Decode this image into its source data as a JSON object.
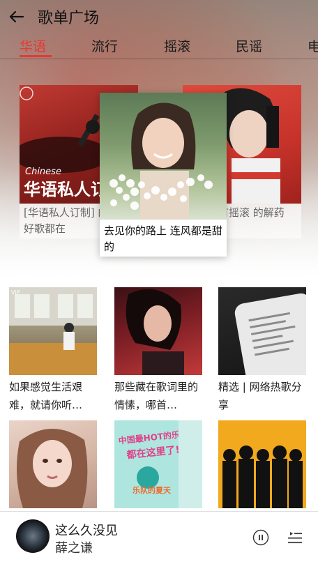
{
  "header": {
    "title": "歌单广场"
  },
  "tabs": [
    {
      "label": "华语",
      "active": true
    },
    {
      "label": "流行",
      "active": false
    },
    {
      "label": "摇滚",
      "active": false
    },
    {
      "label": "民谣",
      "active": false
    },
    {
      "label": "电",
      "active": false
    }
  ],
  "carousel": {
    "left": {
      "caption": "[华语私人订制] 的华语好歌都在",
      "art_text": "华语私人订",
      "art_sub": "Chinese"
    },
    "center": {
      "caption": "去见你的路上 连风都是甜的"
    },
    "right": {
      "caption": "噪：只有摇滚 的解药"
    }
  },
  "grid": [
    {
      "label": "如果感觉生活艰难，就请你听…",
      "badge": "VIP"
    },
    {
      "label": "那些藏在歌词里的情愫，哪首…",
      "badge": ""
    },
    {
      "label": "精选 | 网络热歌分享",
      "badge": ""
    },
    {
      "label": "",
      "badge": ""
    },
    {
      "label": "",
      "badge": "",
      "art_text": "中国最HOT的乐队都在这里了!",
      "art_sub": "乐队的夏天"
    },
    {
      "label": "",
      "badge": ""
    }
  ],
  "player": {
    "song": "这么久没见",
    "artist": "薛之谦"
  },
  "colors": {
    "accent": "#e53935"
  }
}
